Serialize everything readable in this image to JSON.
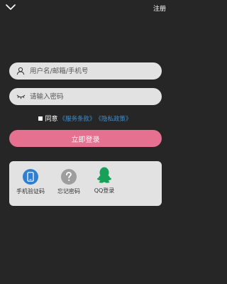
{
  "header": {
    "back_icon": "chevron-down-icon",
    "register_label": "注册"
  },
  "form": {
    "username_placeholder": "用户名/邮箱/手机号",
    "password_placeholder": "请输入密码",
    "username_icon": "user-icon",
    "password_icon": "eye-closed-icon"
  },
  "agreement": {
    "checked": false,
    "prefix": "同意",
    "terms_link": "《服务条款》",
    "privacy_link": "《隐私政策》"
  },
  "login_button": {
    "label": "立即登录"
  },
  "alt_logins": [
    {
      "label": "手机验证码",
      "icon": "phone-icon"
    },
    {
      "label": "忘记密码",
      "icon": "question-mark-icon"
    },
    {
      "label": "QQ登录",
      "icon": "qq-penguin-icon"
    }
  ],
  "colors": {
    "background": "#262626",
    "input_background": "#e2e2e2",
    "login_button": "#e5708f",
    "link": "#3a8fd6",
    "phone_icon_bg": "#2f7fcf",
    "forgot_icon_bg": "#9e9e9e",
    "qq_icon": "#18a05a"
  }
}
